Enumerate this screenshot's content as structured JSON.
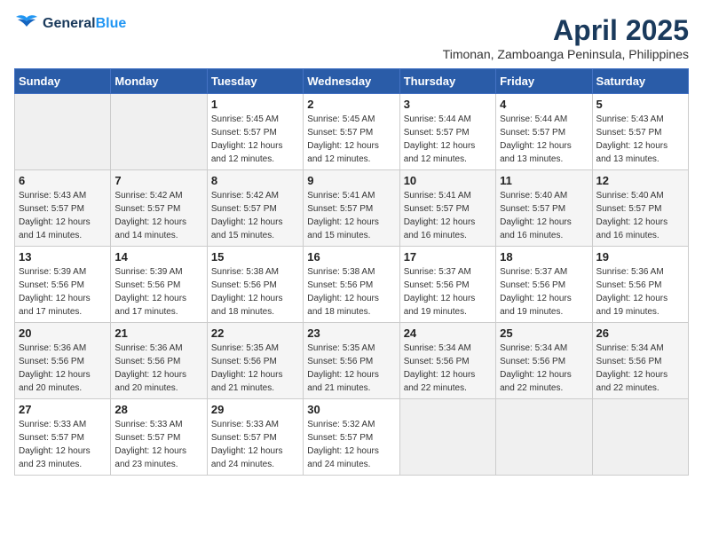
{
  "header": {
    "logo_line1": "General",
    "logo_line2": "Blue",
    "month": "April 2025",
    "location": "Timonan, Zamboanga Peninsula, Philippines"
  },
  "weekdays": [
    "Sunday",
    "Monday",
    "Tuesday",
    "Wednesday",
    "Thursday",
    "Friday",
    "Saturday"
  ],
  "weeks": [
    [
      {
        "day": "",
        "info": ""
      },
      {
        "day": "",
        "info": ""
      },
      {
        "day": "1",
        "info": "Sunrise: 5:45 AM\nSunset: 5:57 PM\nDaylight: 12 hours\nand 12 minutes."
      },
      {
        "day": "2",
        "info": "Sunrise: 5:45 AM\nSunset: 5:57 PM\nDaylight: 12 hours\nand 12 minutes."
      },
      {
        "day": "3",
        "info": "Sunrise: 5:44 AM\nSunset: 5:57 PM\nDaylight: 12 hours\nand 12 minutes."
      },
      {
        "day": "4",
        "info": "Sunrise: 5:44 AM\nSunset: 5:57 PM\nDaylight: 12 hours\nand 13 minutes."
      },
      {
        "day": "5",
        "info": "Sunrise: 5:43 AM\nSunset: 5:57 PM\nDaylight: 12 hours\nand 13 minutes."
      }
    ],
    [
      {
        "day": "6",
        "info": "Sunrise: 5:43 AM\nSunset: 5:57 PM\nDaylight: 12 hours\nand 14 minutes."
      },
      {
        "day": "7",
        "info": "Sunrise: 5:42 AM\nSunset: 5:57 PM\nDaylight: 12 hours\nand 14 minutes."
      },
      {
        "day": "8",
        "info": "Sunrise: 5:42 AM\nSunset: 5:57 PM\nDaylight: 12 hours\nand 15 minutes."
      },
      {
        "day": "9",
        "info": "Sunrise: 5:41 AM\nSunset: 5:57 PM\nDaylight: 12 hours\nand 15 minutes."
      },
      {
        "day": "10",
        "info": "Sunrise: 5:41 AM\nSunset: 5:57 PM\nDaylight: 12 hours\nand 16 minutes."
      },
      {
        "day": "11",
        "info": "Sunrise: 5:40 AM\nSunset: 5:57 PM\nDaylight: 12 hours\nand 16 minutes."
      },
      {
        "day": "12",
        "info": "Sunrise: 5:40 AM\nSunset: 5:57 PM\nDaylight: 12 hours\nand 16 minutes."
      }
    ],
    [
      {
        "day": "13",
        "info": "Sunrise: 5:39 AM\nSunset: 5:56 PM\nDaylight: 12 hours\nand 17 minutes."
      },
      {
        "day": "14",
        "info": "Sunrise: 5:39 AM\nSunset: 5:56 PM\nDaylight: 12 hours\nand 17 minutes."
      },
      {
        "day": "15",
        "info": "Sunrise: 5:38 AM\nSunset: 5:56 PM\nDaylight: 12 hours\nand 18 minutes."
      },
      {
        "day": "16",
        "info": "Sunrise: 5:38 AM\nSunset: 5:56 PM\nDaylight: 12 hours\nand 18 minutes."
      },
      {
        "day": "17",
        "info": "Sunrise: 5:37 AM\nSunset: 5:56 PM\nDaylight: 12 hours\nand 19 minutes."
      },
      {
        "day": "18",
        "info": "Sunrise: 5:37 AM\nSunset: 5:56 PM\nDaylight: 12 hours\nand 19 minutes."
      },
      {
        "day": "19",
        "info": "Sunrise: 5:36 AM\nSunset: 5:56 PM\nDaylight: 12 hours\nand 19 minutes."
      }
    ],
    [
      {
        "day": "20",
        "info": "Sunrise: 5:36 AM\nSunset: 5:56 PM\nDaylight: 12 hours\nand 20 minutes."
      },
      {
        "day": "21",
        "info": "Sunrise: 5:36 AM\nSunset: 5:56 PM\nDaylight: 12 hours\nand 20 minutes."
      },
      {
        "day": "22",
        "info": "Sunrise: 5:35 AM\nSunset: 5:56 PM\nDaylight: 12 hours\nand 21 minutes."
      },
      {
        "day": "23",
        "info": "Sunrise: 5:35 AM\nSunset: 5:56 PM\nDaylight: 12 hours\nand 21 minutes."
      },
      {
        "day": "24",
        "info": "Sunrise: 5:34 AM\nSunset: 5:56 PM\nDaylight: 12 hours\nand 22 minutes."
      },
      {
        "day": "25",
        "info": "Sunrise: 5:34 AM\nSunset: 5:56 PM\nDaylight: 12 hours\nand 22 minutes."
      },
      {
        "day": "26",
        "info": "Sunrise: 5:34 AM\nSunset: 5:56 PM\nDaylight: 12 hours\nand 22 minutes."
      }
    ],
    [
      {
        "day": "27",
        "info": "Sunrise: 5:33 AM\nSunset: 5:57 PM\nDaylight: 12 hours\nand 23 minutes."
      },
      {
        "day": "28",
        "info": "Sunrise: 5:33 AM\nSunset: 5:57 PM\nDaylight: 12 hours\nand 23 minutes."
      },
      {
        "day": "29",
        "info": "Sunrise: 5:33 AM\nSunset: 5:57 PM\nDaylight: 12 hours\nand 24 minutes."
      },
      {
        "day": "30",
        "info": "Sunrise: 5:32 AM\nSunset: 5:57 PM\nDaylight: 12 hours\nand 24 minutes."
      },
      {
        "day": "",
        "info": ""
      },
      {
        "day": "",
        "info": ""
      },
      {
        "day": "",
        "info": ""
      }
    ]
  ]
}
